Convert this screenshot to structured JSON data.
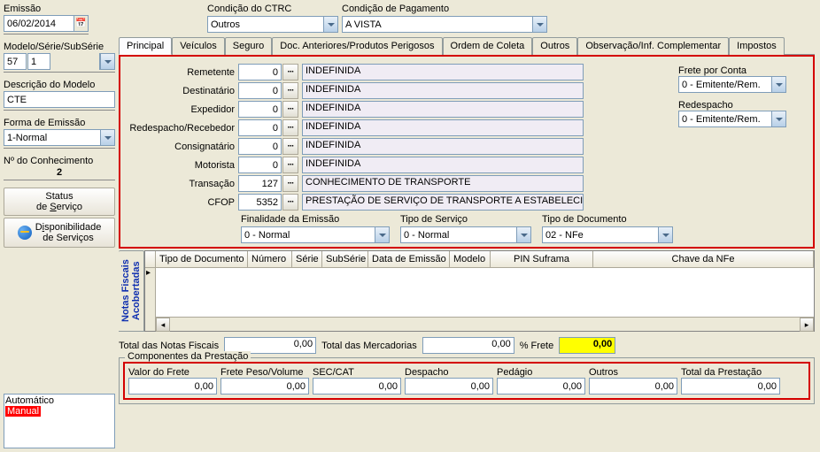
{
  "top": {
    "emissao_label": "Emissão",
    "emissao_value": "06/02/2014",
    "condicao_ctrc_label": "Condição do CTRC",
    "condicao_ctrc_value": "Outros",
    "condicao_pag_label": "Condição de Pagamento",
    "condicao_pag_value": "A VISTA"
  },
  "left": {
    "modelo_label": "Modelo/Série/SubSérie",
    "modelo_v1": "57",
    "modelo_v2": "1",
    "descricao_label": "Descrição do Modelo",
    "descricao_value": "CTE",
    "forma_label": "Forma de Emissão",
    "forma_value": "1-Normal",
    "no_label": "Nº do Conhecimento",
    "no_value": "2",
    "status_btn": "Status\nde Serviço",
    "disp_btn": "Disponibilidade\nde Serviços",
    "list1": "Automático",
    "list2": "Manual"
  },
  "tabs": {
    "t1": "Principal",
    "t2": "Veículos",
    "t3": "Seguro",
    "t4": "Doc. Anteriores/Produtos Perigosos",
    "t5": "Ordem de Coleta",
    "t6": "Outros",
    "t7": "Observação/Inf. Complementar",
    "t8": "Impostos"
  },
  "fields": {
    "remetente": {
      "label": "Remetente",
      "num": "0",
      "desc": "INDEFINIDA"
    },
    "destinatario": {
      "label": "Destinatário",
      "num": "0",
      "desc": "INDEFINIDA"
    },
    "expedidor": {
      "label": "Expedidor",
      "num": "0",
      "desc": "INDEFINIDA"
    },
    "redespacho": {
      "label": "Redespacho/Recebedor",
      "num": "0",
      "desc": "INDEFINIDA"
    },
    "consignatario": {
      "label": "Consignatário",
      "num": "0",
      "desc": "INDEFINIDA"
    },
    "motorista": {
      "label": "Motorista",
      "num": "0",
      "desc": "INDEFINIDA"
    },
    "transacao": {
      "label": "Transação",
      "num": "127",
      "desc": "CONHECIMENTO DE TRANSPORTE"
    },
    "cfop": {
      "label": "CFOP",
      "num": "5352",
      "desc": "PRESTAÇÃO DE SERVIÇO DE TRANSPORTE A ESTABELECIMENT"
    }
  },
  "side": {
    "frete_label": "Frete por Conta",
    "frete_value": "0 - Emitente/Rem.",
    "redesp_label": "Redespacho",
    "redesp_value": "0 - Emitente/Rem."
  },
  "selects": {
    "finalidade_label": "Finalidade da Emissão",
    "finalidade_value": "0 - Normal",
    "tipo_serv_label": "Tipo de Serviço",
    "tipo_serv_value": "0 - Normal",
    "tipo_doc_label": "Tipo de Documento",
    "tipo_doc_value": "02 - NFe"
  },
  "grid": {
    "vtab": "Notas Fiscais\nAcobertadas",
    "c1": "Tipo de Documento",
    "c2": "Número",
    "c3": "Série",
    "c4": "SubSérie",
    "c5": "Data de Emissão",
    "c6": "Modelo",
    "c7": "PIN Suframa",
    "c8": "Chave da NFe"
  },
  "totals": {
    "tnf_label": "Total das Notas Fiscais",
    "tnf_value": "0,00",
    "tmerc_label": "Total das Mercadorias",
    "tmerc_value": "0,00",
    "pfrete_label": "% Frete",
    "pfrete_value": "0,00"
  },
  "comp": {
    "title": "Componentes da Prestação",
    "valor_frete": {
      "label": "Valor do Frete",
      "value": "0,00"
    },
    "peso": {
      "label": "Frete Peso/Volume",
      "value": "0,00"
    },
    "seccat": {
      "label": "SEC/CAT",
      "value": "0,00"
    },
    "despacho": {
      "label": "Despacho",
      "value": "0,00"
    },
    "pedagio": {
      "label": "Pedágio",
      "value": "0,00"
    },
    "outros": {
      "label": "Outros",
      "value": "0,00"
    },
    "total": {
      "label": "Total da Prestação",
      "value": "0,00"
    }
  }
}
